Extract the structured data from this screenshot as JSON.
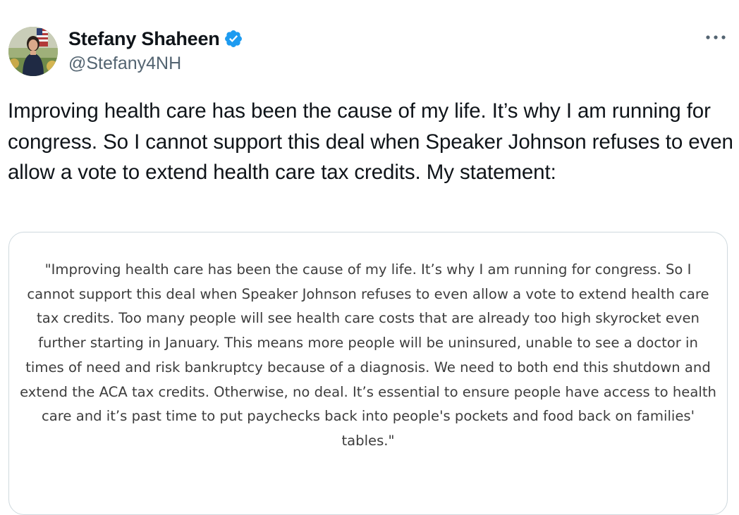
{
  "author": {
    "display_name": "Stefany Shaheen",
    "handle": "@Stefany4NH",
    "verified": true
  },
  "tweet": {
    "text": "Improving health care has been the cause of my life. It’s why I am running for congress. So I cannot support this deal when Speaker Johnson refuses to even allow a vote to extend health care tax credits. My statement:"
  },
  "media": {
    "statement_text": "\"Improving health care has been the cause of my life. It’s why I am running for congress. So I cannot support this deal when Speaker Johnson refuses to even allow a vote to extend health care tax credits. Too many people will see health care costs that are already too high skyrocket even further starting in January. This means more people will be uninsured, unable to see a doctor in times of need and risk bankruptcy because of a diagnosis.  We need to both end this shutdown and extend the ACA tax credits. Otherwise, no deal. It’s essential to ensure people have access to health care and it’s past time to put paychecks back into people's pockets and food back on families' tables.\""
  },
  "icons": {
    "verified": "verified-badge-icon",
    "more": "more-horizontal-icon"
  },
  "colors": {
    "text_primary": "#0f1419",
    "text_secondary": "#536471",
    "verified_blue": "#1d9bf0",
    "card_border": "#cfd9de",
    "statement_text": "#3d3d3d"
  }
}
